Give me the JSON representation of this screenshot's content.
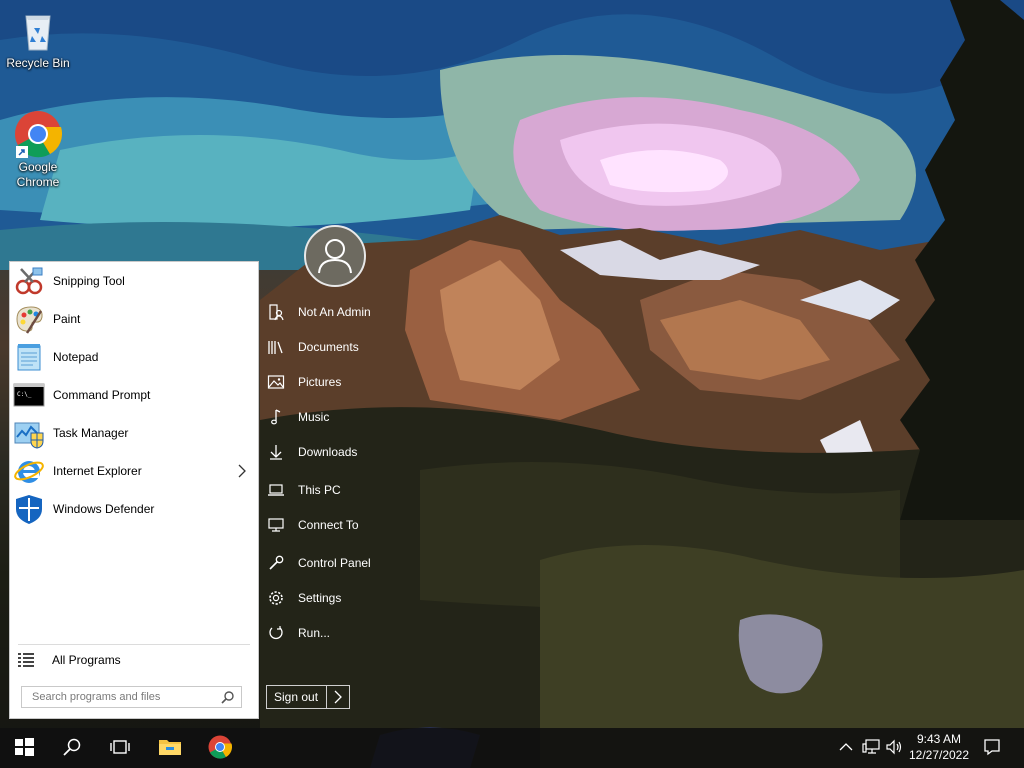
{
  "desktop": {
    "icons": [
      {
        "label": "Recycle Bin",
        "icon": "recycle-bin-icon"
      },
      {
        "label_line1": "Google",
        "label_line2": "Chrome",
        "icon": "chrome-icon"
      }
    ]
  },
  "start_menu": {
    "programs": [
      {
        "label": "Snipping Tool",
        "icon": "snipping-tool-icon"
      },
      {
        "label": "Paint",
        "icon": "paint-icon"
      },
      {
        "label": "Notepad",
        "icon": "notepad-icon"
      },
      {
        "label": "Command Prompt",
        "icon": "command-prompt-icon"
      },
      {
        "label": "Task Manager",
        "icon": "task-manager-icon"
      },
      {
        "label": "Internet Explorer",
        "icon": "internet-explorer-icon",
        "has_submenu": true
      },
      {
        "label": "Windows Defender",
        "icon": "windows-defender-icon"
      }
    ],
    "all_programs": "All Programs",
    "search_placeholder": "Search programs and files",
    "right_items": [
      {
        "label": "Not An Admin",
        "icon": "user-folder-icon"
      },
      {
        "label": "Documents",
        "icon": "documents-icon"
      },
      {
        "label": "Pictures",
        "icon": "pictures-icon"
      },
      {
        "label": "Music",
        "icon": "music-icon"
      },
      {
        "label": "Downloads",
        "icon": "downloads-icon"
      },
      {
        "label": "This PC",
        "icon": "this-pc-icon"
      },
      {
        "label": "Connect To",
        "icon": "connect-to-icon"
      },
      {
        "label": "Control Panel",
        "icon": "control-panel-icon"
      },
      {
        "label": "Settings",
        "icon": "settings-icon"
      },
      {
        "label": "Run...",
        "icon": "run-icon"
      }
    ],
    "sign_out": "Sign out"
  },
  "taskbar": {
    "buttons": [
      "start-button",
      "search-button",
      "task-view-button",
      "file-explorer-button",
      "chrome-button"
    ],
    "clock": {
      "time": "9:43 AM",
      "date": "12/27/2022"
    }
  },
  "colors": {
    "taskbar": "#101010",
    "menu_left": "#ffffff",
    "accent_blue": "#0078d7"
  }
}
